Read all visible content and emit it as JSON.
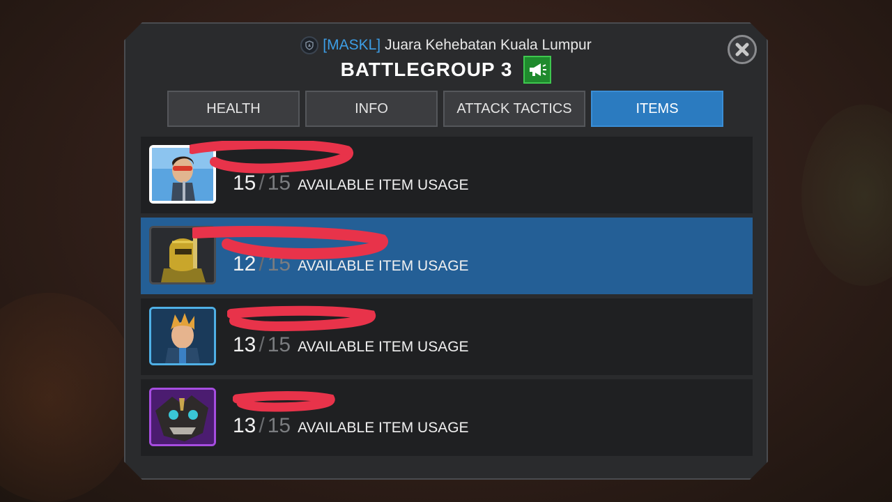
{
  "header": {
    "alliance_tag": "[MASKL]",
    "alliance_name": "Juara Kehebatan Kuala Lumpur",
    "title": "BATTLEGROUP 3"
  },
  "icons": {
    "alliance": "shield-icon",
    "announce": "megaphone-icon",
    "close": "close-icon"
  },
  "colors": {
    "accent": "#2b7bc0",
    "tag": "#3d9ee6",
    "announce": "#1f8a2d",
    "redaction": "#e8334a"
  },
  "tabs": [
    {
      "label": "HEALTH",
      "active": false
    },
    {
      "label": "INFO",
      "active": false
    },
    {
      "label": "ATTACK TACTICS",
      "active": false
    },
    {
      "label": "ITEMS",
      "active": true
    }
  ],
  "members": [
    {
      "current": "15",
      "max": "15",
      "label": "AVAILABLE ITEM USAGE",
      "selected": false
    },
    {
      "current": "12",
      "max": "15",
      "label": "AVAILABLE ITEM USAGE",
      "selected": true
    },
    {
      "current": "13",
      "max": "15",
      "label": "AVAILABLE ITEM USAGE",
      "selected": false
    },
    {
      "current": "13",
      "max": "15",
      "label": "AVAILABLE ITEM USAGE",
      "selected": false
    }
  ]
}
